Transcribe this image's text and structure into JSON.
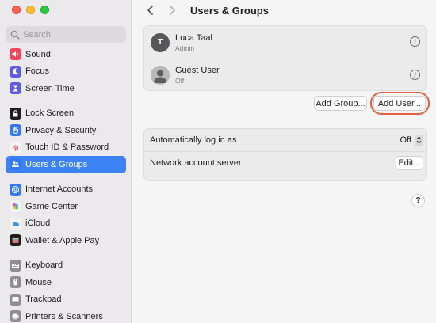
{
  "window": {
    "title": "Users & Groups"
  },
  "search": {
    "placeholder": "Search"
  },
  "sidebar": {
    "groups": [
      [
        {
          "label": "Sound",
          "icon": "speaker-icon",
          "color": "#f0455c"
        },
        {
          "label": "Focus",
          "icon": "moon-icon",
          "color": "#5e5ce6"
        },
        {
          "label": "Screen Time",
          "icon": "hourglass-icon",
          "color": "#5e5ce6"
        }
      ],
      [
        {
          "label": "Lock Screen",
          "icon": "lock-icon",
          "color": "#1d1d1f"
        },
        {
          "label": "Privacy & Security",
          "icon": "hand-icon",
          "color": "#3478f6"
        },
        {
          "label": "Touch ID & Password",
          "icon": "fingerprint-icon",
          "color": "#f2f2f2"
        },
        {
          "label": "Users & Groups",
          "icon": "users-icon",
          "color": "#3478f6",
          "active": true
        }
      ],
      [
        {
          "label": "Internet Accounts",
          "icon": "at-icon",
          "color": "#3478f6"
        },
        {
          "label": "Game Center",
          "icon": "game-center-icon",
          "color": "#f2f2f2"
        },
        {
          "label": "iCloud",
          "icon": "cloud-icon",
          "color": "#f2f2f2"
        },
        {
          "label": "Wallet & Apple Pay",
          "icon": "wallet-icon",
          "color": "#1d1d1f"
        }
      ],
      [
        {
          "label": "Keyboard",
          "icon": "keyboard-icon",
          "color": "#8e8e93"
        },
        {
          "label": "Mouse",
          "icon": "mouse-icon",
          "color": "#8e8e93"
        },
        {
          "label": "Trackpad",
          "icon": "trackpad-icon",
          "color": "#8e8e93"
        },
        {
          "label": "Printers & Scanners",
          "icon": "printer-icon",
          "color": "#8e8e93"
        }
      ]
    ]
  },
  "users": [
    {
      "name": "Luca Taal",
      "role": "Admin",
      "initial": "T"
    },
    {
      "name": "Guest User",
      "role": "Off"
    }
  ],
  "actions": {
    "add_group": "Add Group...",
    "add_user": "Add User..."
  },
  "settings": {
    "auto_login_label": "Automatically log in as",
    "auto_login_value": "Off",
    "network_label": "Network account server",
    "edit_label": "Edit..."
  },
  "help": {
    "label": "?"
  },
  "colors": {
    "accent": "#3b82f6",
    "highlight_ring": "#e06140"
  }
}
